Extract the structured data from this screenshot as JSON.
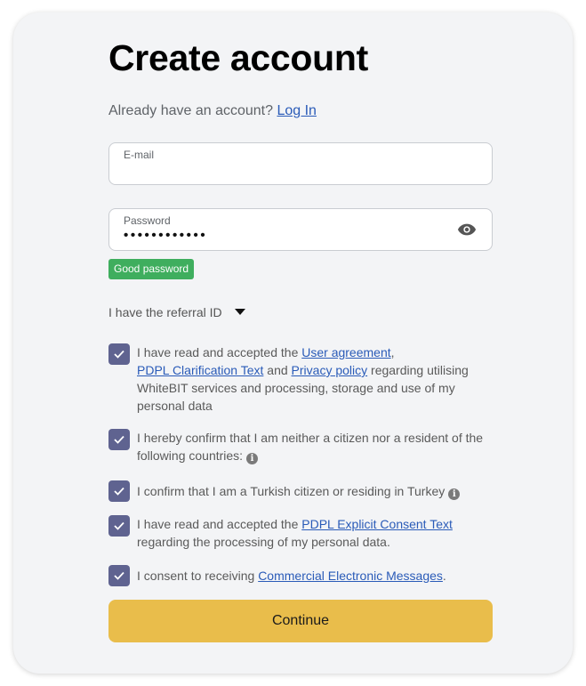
{
  "title": "Create account",
  "login_prompt": {
    "text": "Already have an account?",
    "link": "Log In"
  },
  "email": {
    "label": "E-mail",
    "value": ""
  },
  "password": {
    "label": "Password",
    "masked_value": "••••••••••••",
    "strength": "Good password"
  },
  "referral": {
    "label": "I have the referral ID"
  },
  "agreements": [
    {
      "checked": true,
      "t1": "I have read and accepted the ",
      "link1": "User agreement",
      "t2": ",",
      "link2": "PDPL Clarification Text",
      "t3": " and ",
      "link3": "Privacy policy",
      "t4": " regarding utilising WhiteBIT services and processing, storage and use of my personal data"
    },
    {
      "checked": true,
      "t1": "I hereby confirm that I am neither a citizen nor a resident of the following countries:"
    },
    {
      "checked": true,
      "t1": "I confirm that I am a Turkish citizen or residing in Turkey"
    },
    {
      "checked": true,
      "t1": "I have read and accepted the ",
      "link1": "PDPL Explicit Consent Text",
      "t2": " regarding the processing of my personal data."
    },
    {
      "checked": true,
      "t1": "I consent to receiving ",
      "link1": "Commercial Electronic Messages",
      "t2": "."
    }
  ],
  "continue_label": "Continue",
  "colors": {
    "accent_button": "#e9bd4b",
    "checkbox": "#5f6390",
    "link": "#2a5bb8",
    "badge_good": "#3fae5e"
  }
}
